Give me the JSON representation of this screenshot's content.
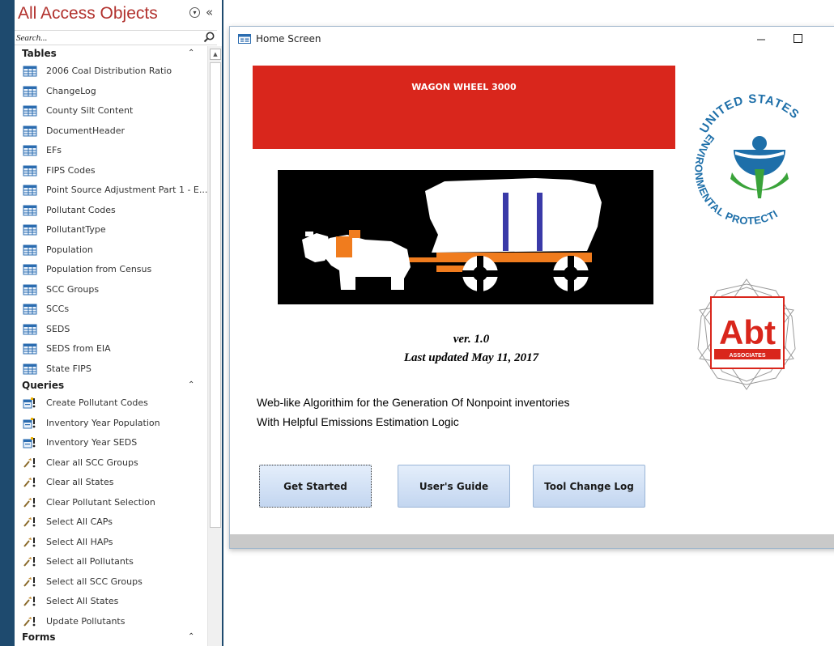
{
  "nav": {
    "title": "All Access Objects",
    "search_placeholder": "Search...",
    "sections": {
      "tables": "Tables",
      "queries": "Queries",
      "forms": "Forms"
    },
    "tables": [
      "2006 Coal Distribution Ratio",
      "ChangeLog",
      "County Silt Content",
      "DocumentHeader",
      "EFs",
      "FIPS Codes",
      "Point Source Adjustment Part 1 - E...",
      "Pollutant Codes",
      "PollutantType",
      "Population",
      "Population from Census",
      "SCC Groups",
      "SCCs",
      "SEDS",
      "SEDS from EIA",
      "State FIPS"
    ],
    "queries": [
      {
        "label": "Create Pollutant Codes",
        "icon": "make-table-query-icon"
      },
      {
        "label": "Inventory Year Population",
        "icon": "make-table-query-icon"
      },
      {
        "label": "Inventory Year SEDS",
        "icon": "make-table-query-icon"
      },
      {
        "label": "Clear all SCC Groups",
        "icon": "update-query-icon"
      },
      {
        "label": "Clear all States",
        "icon": "update-query-icon"
      },
      {
        "label": "Clear Pollutant Selection",
        "icon": "update-query-icon"
      },
      {
        "label": "Select All CAPs",
        "icon": "update-query-icon"
      },
      {
        "label": "Select All HAPs",
        "icon": "update-query-icon"
      },
      {
        "label": "Select all Pollutants",
        "icon": "update-query-icon"
      },
      {
        "label": "Select all SCC Groups",
        "icon": "update-query-icon"
      },
      {
        "label": "Select All States",
        "icon": "update-query-icon"
      },
      {
        "label": "Update Pollutants",
        "icon": "update-query-icon"
      }
    ]
  },
  "form": {
    "title": "Home Screen",
    "banner": "WAGON WHEEL 3000",
    "version": "ver. 1.0",
    "updated": "Last updated May 11, 2017",
    "description_line1": "Web-like Algorithim for the Generation Of Nonpoint inventories",
    "description_line2": "With Helpful Emissions Estimation Logic",
    "buttons": {
      "get_started": "Get Started",
      "users_guide": "User's Guide",
      "change_log": "Tool Change Log"
    },
    "epa_logo": {
      "top_text": "UNITED STATES",
      "left_text": "ENVIRONMENTAL PROTECTION AGENCY"
    },
    "abt_logo": {
      "name": "Abt",
      "sub": "ASSOCIATES"
    }
  },
  "colors": {
    "accent_red": "#d9261c",
    "nav_title": "#b2322e",
    "epa_blue": "#1e6fa9",
    "epa_green": "#3aa33a",
    "wagon_orange": "#f07c1e",
    "wagon_blue": "#3a3aa8"
  }
}
